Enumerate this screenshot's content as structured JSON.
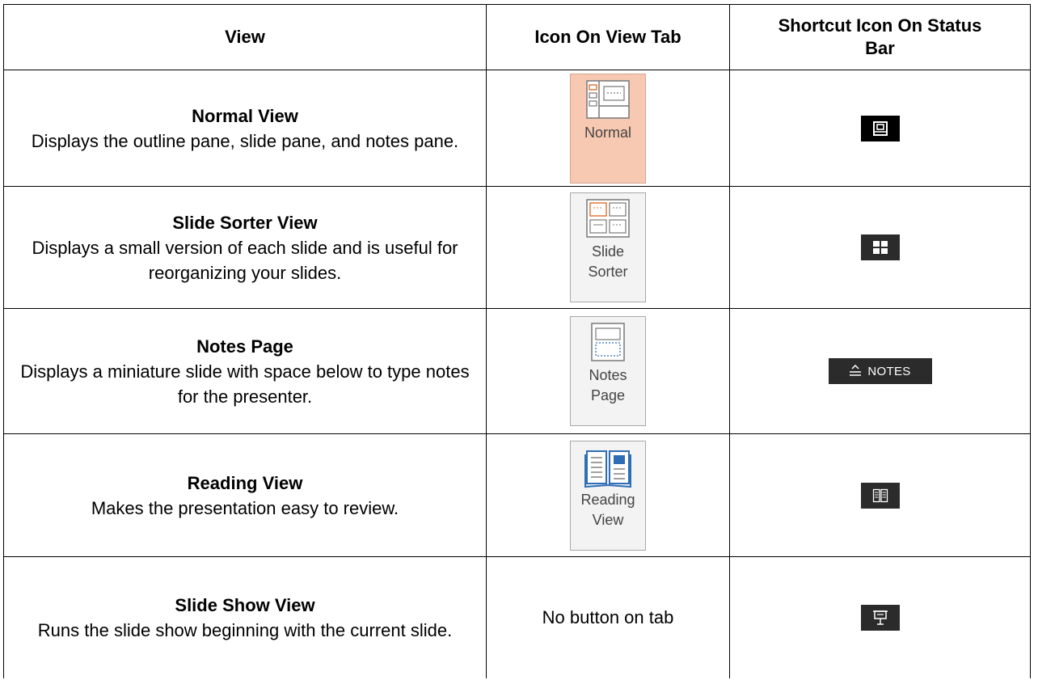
{
  "headers": {
    "view": "View",
    "icon_on_tab": "Icon On View Tab",
    "shortcut": "Shortcut Icon On Status Bar"
  },
  "rows": [
    {
      "name": "Normal View",
      "description": "Displays the outline pane, slide pane, and notes pane.",
      "button_label": "Normal",
      "button_icon": "normal-view-icon",
      "button_active": true,
      "shortcut_icon": "normal-view-shortcut-icon",
      "shortcut_label": ""
    },
    {
      "name": "Slide Sorter View",
      "description": "Displays a small version of each slide and is useful for reorganizing your slides.",
      "button_label": "Slide\nSorter",
      "button_icon": "slide-sorter-icon",
      "shortcut_icon": "slide-sorter-shortcut-icon",
      "shortcut_label": ""
    },
    {
      "name": "Notes Page",
      "description": "Displays a miniature slide with space below to type notes for the presenter.",
      "button_label": "Notes\nPage",
      "button_icon": "notes-page-icon",
      "shortcut_icon": "notes-shortcut-icon",
      "shortcut_label": "NOTES"
    },
    {
      "name": "Reading View",
      "description": "Makes the presentation easy to review.",
      "button_label": "Reading\nView",
      "button_icon": "reading-view-icon",
      "shortcut_icon": "reading-view-shortcut-icon",
      "shortcut_label": ""
    },
    {
      "name": "Slide Show View",
      "description": "Runs the slide show beginning with the current slide.",
      "no_button_text": "No button on tab",
      "shortcut_icon": "slide-show-shortcut-icon",
      "shortcut_label": ""
    }
  ],
  "colors": {
    "active_button_bg": "#f8c9b2",
    "button_bg": "#f3f3f3",
    "shortcut_bg": "#2b2b2b",
    "icon_orange": "#e07a3c",
    "icon_blue": "#2f6eb5"
  }
}
